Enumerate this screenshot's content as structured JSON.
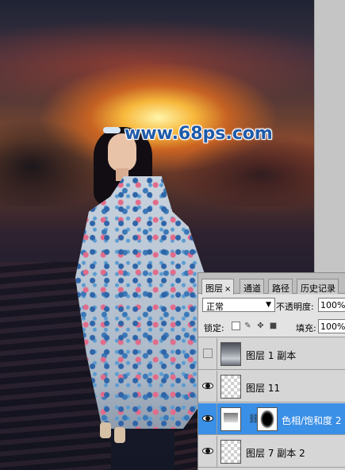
{
  "canvas": {
    "watermark": "www.68ps.com"
  },
  "layers_panel": {
    "tabs": [
      {
        "label": "图层",
        "close": "×"
      },
      {
        "label": "通道"
      },
      {
        "label": "路径"
      },
      {
        "label": "历史记录"
      }
    ],
    "blend_mode": "正常",
    "opacity_label": "不透明度:",
    "opacity_value": "100%",
    "lock_label": "锁定:",
    "fill_label": "填充:",
    "fill_value": "100%",
    "layers": [
      {
        "name": "图层 1 副本",
        "visible": false,
        "thumb": "photo"
      },
      {
        "name": "图层 11",
        "visible": true,
        "thumb": "transparent"
      },
      {
        "name": "色相/饱和度 2",
        "visible": true,
        "thumb": "adjustment",
        "mask": true,
        "selected": true
      },
      {
        "name": "图层 7 副本 2",
        "visible": true,
        "thumb": "transparent"
      }
    ]
  }
}
